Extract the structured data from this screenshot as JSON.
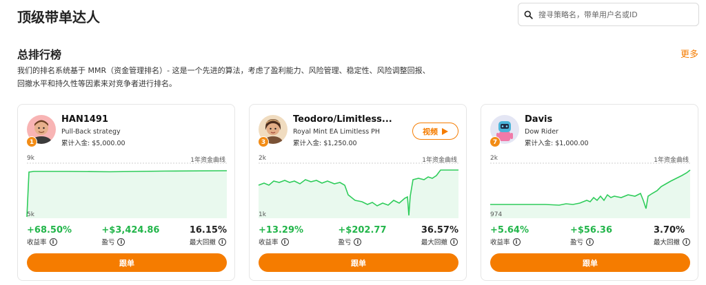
{
  "header": {
    "title": "顶级带单达人",
    "search_placeholder": "搜寻策略名，带单用户名或ID"
  },
  "section": {
    "title": "总排行榜",
    "more_label": "更多",
    "description": "我们的排名系统基于 MMR（资金管理排名）- 这是一个先进的算法，考虑了盈利能力、风险管理、稳定性、风险调整回报、回撤水平和持久性等因素来对竞争者进行排名。"
  },
  "colors": {
    "accent": "#f57c00",
    "positive": "#22b54a",
    "chart_line": "#2ecc5a",
    "chart_fill": "#e9f9ee",
    "rank_badge": "#f28c16"
  },
  "cards": [
    {
      "rank": "1",
      "avatar_icon": "avatar-man-icon",
      "name": "HAN1491",
      "strategy": "Pull-Back strategy",
      "deposit": "累计入金: $5,000.00",
      "chart_top": "9k",
      "chart_bottom": "5k",
      "curve_label": "1年资金曲线",
      "return_value": "+68.50%",
      "return_label": "收益率",
      "pnl_value": "+$3,424.86",
      "pnl_label": "盈亏",
      "drawdown_value": "16.15%",
      "drawdown_label": "最大回撤",
      "follow_label": "跟单"
    },
    {
      "rank": "3",
      "avatar_icon": "avatar-woman-icon",
      "name": "Teodoro/Limitless...",
      "strategy": "Royal Mint EA Limitless PH",
      "deposit": "累计入金: $1,250.00",
      "video_label": "视频",
      "chart_top": "2k",
      "chart_bottom": "1k",
      "curve_label": "1年资金曲线",
      "return_value": "+13.29%",
      "return_label": "收益率",
      "pnl_value": "+$202.77",
      "pnl_label": "盈亏",
      "drawdown_value": "36.57%",
      "drawdown_label": "最大回撤",
      "follow_label": "跟单"
    },
    {
      "rank": "7",
      "avatar_icon": "avatar-figure-icon",
      "name": "Davis",
      "strategy": "Dow Rider",
      "deposit": "累计入金: $1,000.00",
      "chart_top": "2k",
      "chart_bottom": "974",
      "curve_label": "1年资金曲线",
      "return_value": "+5.64%",
      "return_label": "收益率",
      "pnl_value": "+$56.36",
      "pnl_label": "盈亏",
      "drawdown_value": "3.70%",
      "drawdown_label": "最大回撤",
      "follow_label": "跟单"
    }
  ]
}
